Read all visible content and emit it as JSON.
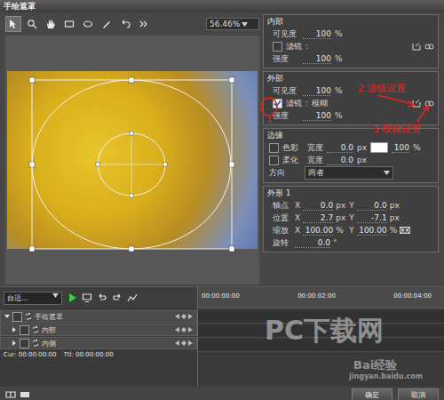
{
  "window": {
    "title": "手绘遮罩"
  },
  "toolbar": {
    "tools": [
      {
        "selected": true
      },
      {
        "selected": false
      },
      {
        "selected": false
      },
      {
        "selected": false
      },
      {
        "selected": false
      },
      {
        "selected": false
      },
      {
        "selected": false
      },
      {
        "selected": false
      }
    ],
    "zoom": "56.46%"
  },
  "groups": [
    {
      "title": "内部",
      "rows": [
        {
          "kind": "value",
          "label": "可见度",
          "value": "100",
          "unit": "%"
        },
        {
          "kind": "filter",
          "label": "滤镜",
          "checked": false,
          "sep": ":",
          "value": ""
        },
        {
          "kind": "value",
          "label": "强度",
          "value": "100",
          "unit": "%"
        }
      ]
    },
    {
      "title": "外部",
      "rows": [
        {
          "kind": "value",
          "label": "可见度",
          "value": "100",
          "unit": "%"
        },
        {
          "kind": "filter",
          "label": "滤镜",
          "checked": true,
          "sep": ":",
          "value": "模糊"
        },
        {
          "kind": "value",
          "label": "强度",
          "value": "100",
          "unit": "%"
        }
      ]
    },
    {
      "title": "边缘",
      "rows": [
        {
          "kind": "edge",
          "label": "色彩",
          "checked": false,
          "sub": "宽度",
          "value": "0.0",
          "unit": "px",
          "swatch": "#ffffff",
          "percent": "100",
          "percent_unit": "%"
        },
        {
          "kind": "edge",
          "label": "柔化",
          "checked": false,
          "sub": "宽度",
          "value": "0.0",
          "unit": "px"
        },
        {
          "kind": "select",
          "label": "方向",
          "value": "两者"
        }
      ]
    },
    {
      "title": "外形 1",
      "rows": [
        {
          "kind": "xy",
          "label": "轴点",
          "x_label": "X",
          "x": "0.0",
          "x_unit": "px",
          "y_label": "Y",
          "y": "0.0",
          "y_unit": "px",
          "linked": false
        },
        {
          "kind": "xy",
          "label": "位置",
          "x_label": "X",
          "x": "2.7",
          "x_unit": "px",
          "y_label": "Y",
          "y": "-7.1",
          "y_unit": "px",
          "linked": false
        },
        {
          "kind": "xy",
          "label": "缩放",
          "x_label": "X",
          "x": "100.00",
          "x_unit": "%",
          "y_label": "Y",
          "y": "100.00",
          "y_unit": "%",
          "linked": true
        },
        {
          "kind": "single",
          "label": "旋转",
          "value": "0.0",
          "unit": "°"
        }
      ]
    }
  ],
  "annotations": [
    {
      "text": "1"
    },
    {
      "text": "2 滤镜设置"
    },
    {
      "text": "3 模糊设置"
    }
  ],
  "timeline": {
    "fit": "自适...",
    "tracks": [
      {
        "label": "手绘遮罩",
        "expanded": true,
        "child": false,
        "checked": false
      },
      {
        "label": "内部",
        "expanded": false,
        "child": true,
        "checked": false
      },
      {
        "label": "内侧",
        "expanded": false,
        "child": true,
        "checked": false
      }
    ],
    "cur_label": "Cur:",
    "cur": "00:00:00:00",
    "ttl_label": "Ttl:",
    "ttl": "00:00:00:00",
    "ruler": [
      "00:00:00:00",
      "00:00:02:00",
      "00:00:04:00"
    ]
  },
  "buttons": [
    "确定",
    "取消"
  ],
  "watermarks": [
    "PC下载网",
    "Bai经验",
    "jingyan.baidu.com"
  ]
}
